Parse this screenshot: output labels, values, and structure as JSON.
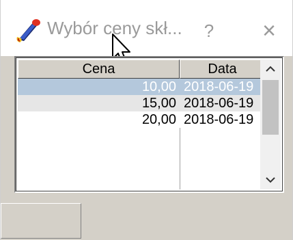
{
  "window": {
    "title": "Wybór ceny skł...",
    "help_label": "?",
    "close_label": "×"
  },
  "grid": {
    "columns": [
      "Cena",
      "Data"
    ],
    "rows": [
      {
        "cena": "10,00",
        "data": "2018-06-19",
        "selected": true
      },
      {
        "cena": "15,00",
        "data": "2018-06-19",
        "selected": false
      },
      {
        "cena": "20,00",
        "data": "2018-06-19",
        "selected": false
      }
    ]
  },
  "scrollbar": {
    "up_icon": "chevron-up-icon",
    "down_icon": "chevron-down-icon"
  },
  "colors": {
    "selected_row": "#b4c8dc",
    "alt_row": "#e6e6e6",
    "client_bg": "#d4d0c8"
  }
}
